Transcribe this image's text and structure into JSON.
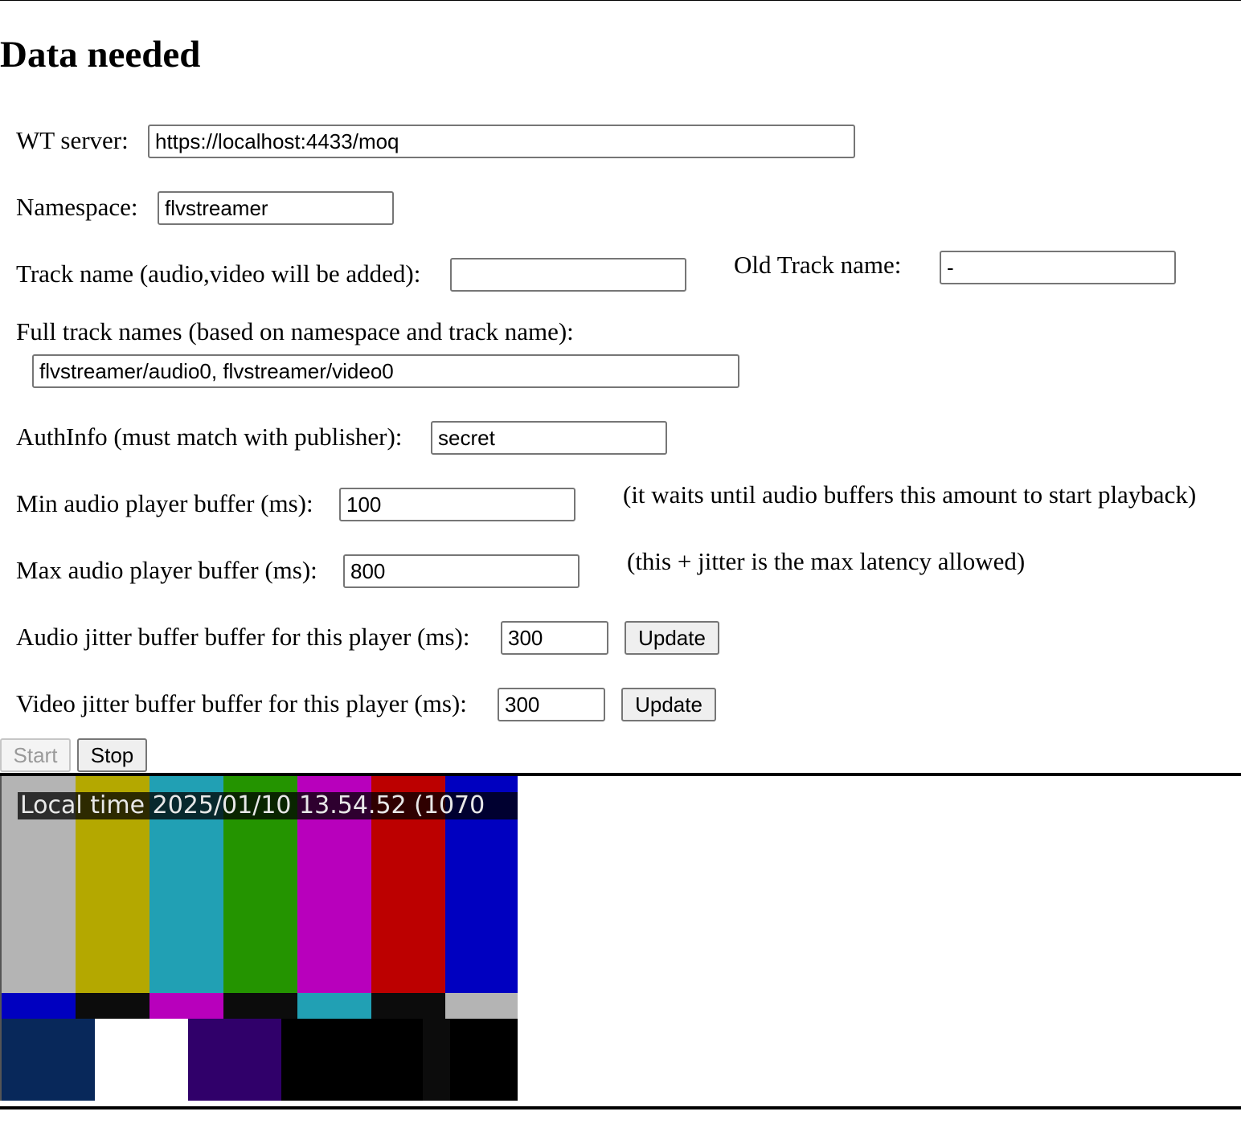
{
  "page": {
    "title": "Data needed"
  },
  "form": {
    "wt_server": {
      "label": "WT server:",
      "value": "https://localhost:4433/moq"
    },
    "namespace": {
      "label": "Namespace:",
      "value": "flvstreamer"
    },
    "track_name": {
      "label": "Track name (audio,video will be added):",
      "value": ""
    },
    "old_track_name": {
      "label": "Old Track name:",
      "value": "-"
    },
    "full_track_names": {
      "label": "Full track names (based on namespace and track name):",
      "value": "flvstreamer/audio0, flvstreamer/video0"
    },
    "auth_info": {
      "label": "AuthInfo (must match with publisher):",
      "value": "secret"
    },
    "min_audio_buffer": {
      "label": "Min audio player buffer (ms):",
      "value": "100",
      "hint": "(it waits until audio buffers this amount to start playback)"
    },
    "max_audio_buffer": {
      "label": "Max audio player buffer (ms):",
      "value": "800",
      "hint": "(this + jitter is the max latency allowed)"
    },
    "audio_jitter": {
      "label": "Audio jitter buffer buffer for this player (ms):",
      "value": "300",
      "button": "Update"
    },
    "video_jitter": {
      "label": "Video jitter buffer buffer for this player (ms):",
      "value": "300",
      "button": "Update"
    }
  },
  "controls": {
    "start": "Start",
    "start_disabled": true,
    "stop": "Stop"
  },
  "video": {
    "overlay_text": "Local time 2025/01/10 13.54.52 (1070",
    "bars_top": [
      "#b4b4b4",
      "#b4a800",
      "#21a0b4",
      "#249400",
      "#b800bc",
      "#bc0000",
      "#0000c0"
    ],
    "bars_mid": [
      "#0000c0",
      "#0c0c0c",
      "#b800bc",
      "#0c0c0c",
      "#21a0b4",
      "#0c0c0c",
      "#b4b4b4"
    ],
    "bars_bottom": [
      "#08285a",
      "#ffffff",
      "#30006a",
      "#000000",
      "#0c0c0c",
      "#000000"
    ]
  }
}
